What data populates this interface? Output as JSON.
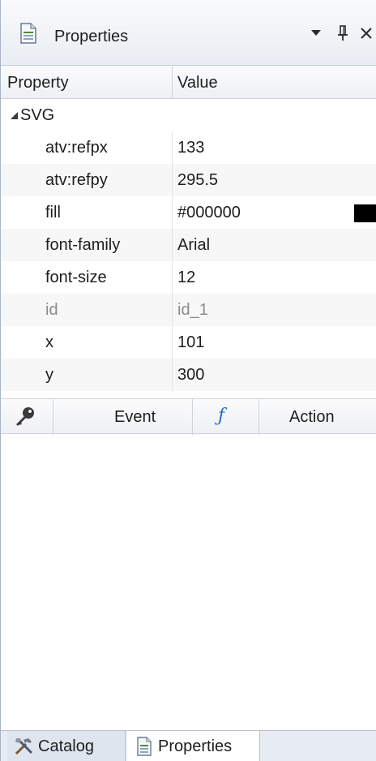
{
  "panel": {
    "title": "Properties",
    "icons": {
      "panel": "properties-page-icon",
      "dropdown": "dropdown-arrow-icon",
      "pin": "pin-icon",
      "close": "close-icon"
    }
  },
  "grid": {
    "header_property": "Property",
    "header_value": "Value",
    "category": "SVG",
    "rows": [
      {
        "name": "atv:refpx",
        "value": "133"
      },
      {
        "name": "atv:refpy",
        "value": "295.5"
      },
      {
        "name": "fill",
        "value": "#000000",
        "swatch_color": "#000000"
      },
      {
        "name": "font-family",
        "value": "Arial"
      },
      {
        "name": "font-size",
        "value": "12"
      },
      {
        "name": "id",
        "value": "id_1",
        "disabled": true
      },
      {
        "name": "x",
        "value": "101"
      },
      {
        "name": "y",
        "value": "300"
      }
    ]
  },
  "events": {
    "event_label": "Event",
    "action_label": "Action",
    "icons": {
      "key": "key-icon",
      "function": "function-icon"
    }
  },
  "tabs": [
    {
      "label": "Catalog",
      "icon": "tools-icon"
    },
    {
      "label": "Properties",
      "icon": "properties-page-icon"
    }
  ]
}
